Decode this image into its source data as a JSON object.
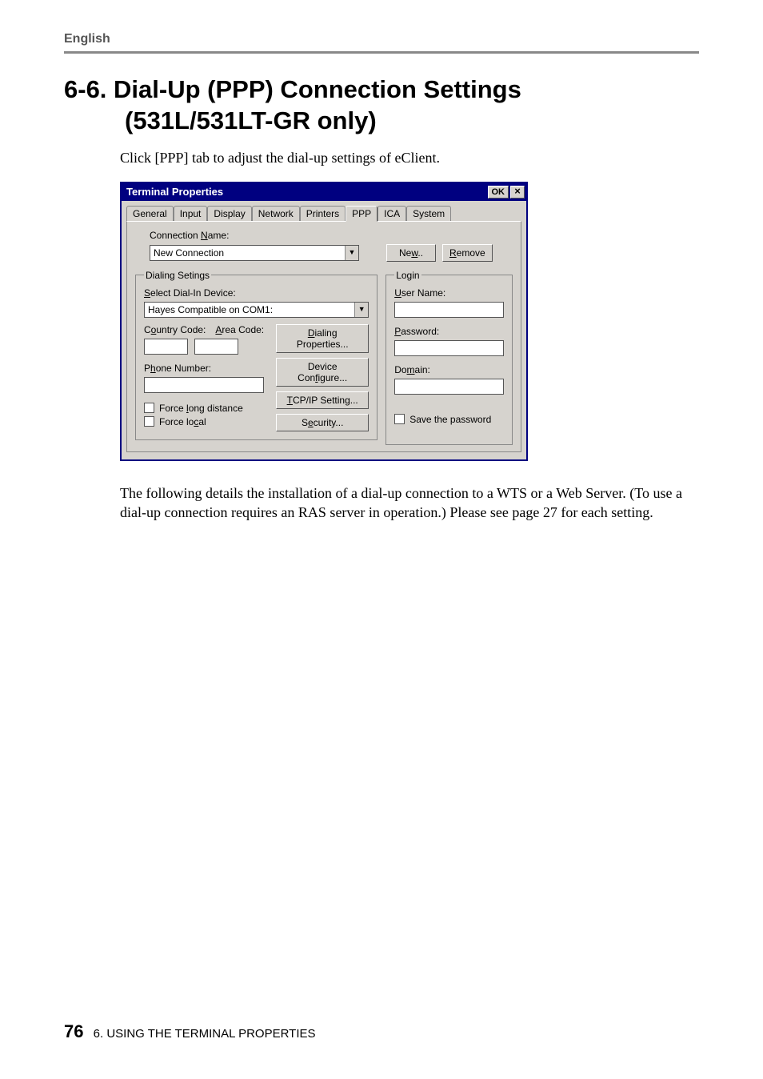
{
  "header": {
    "language": "English"
  },
  "section": {
    "number_title_line1": "6-6. Dial-Up (PPP) Connection Settings",
    "title_line2": "(531L/531LT-GR only)",
    "intro": "Click [PPP] tab to adjust the dial-up settings of eClient.",
    "after": "The following details the installation of a dial-up connection to a WTS or a Web Server. (To use a dial-up connection requires an RAS server in operation.)  Please see page 27 for each setting."
  },
  "dialog": {
    "title": "Terminal Properties",
    "ok": "OK",
    "close": "×",
    "tabs": [
      "General",
      "Input",
      "Display",
      "Network",
      "Printers",
      "PPP",
      "ICA",
      "System"
    ],
    "active_tab": "PPP",
    "connection_name_label": "Connection Name:",
    "connection_name_value": "New Connection",
    "new_btn": "New..",
    "remove_btn": "Remove",
    "dialing_legend": "Dialing Setings",
    "select_device_label": "Select Dial-In Device:",
    "device_value": "Hayes Compatible on COM1:",
    "country_label": "Country Code:",
    "area_label": "Area Code:",
    "phone_label": "Phone Number:",
    "dialing_props_btn": "Dialing Properties...",
    "device_cfg_btn": "Device Configure...",
    "tcpip_btn": "TCP/IP Setting...",
    "security_btn": "Security...",
    "force_long": "Force long distance",
    "force_local": "Force local",
    "login_legend": "Login",
    "user_label": "User Name:",
    "pass_label": "Password:",
    "domain_label": "Domain:",
    "save_pw": "Save the password"
  },
  "footer": {
    "page": "76",
    "chapter": "6. USING THE TERMINAL PROPERTIES"
  }
}
